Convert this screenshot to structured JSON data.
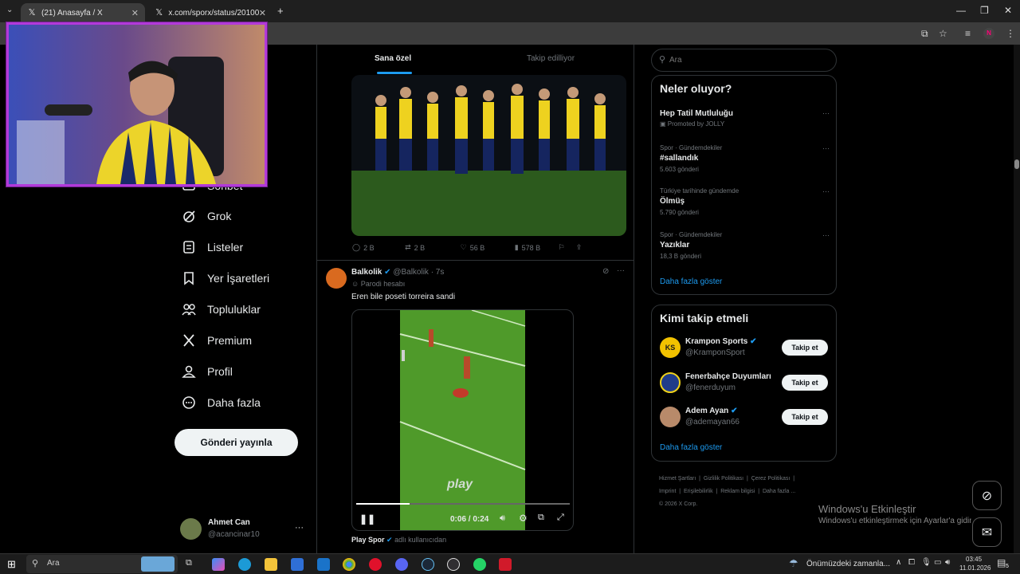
{
  "browser": {
    "tabs": [
      {
        "title": "(21) Anasayfa / X",
        "active": true
      },
      {
        "title": "x.com/sporx/status/201007797...",
        "active": false
      }
    ]
  },
  "nav": {
    "items": [
      {
        "key": "sohbet",
        "label": "Sohbet",
        "icon": "chat-icon"
      },
      {
        "key": "grok",
        "label": "Grok",
        "icon": "grok-icon"
      },
      {
        "key": "listeler",
        "label": "Listeler",
        "icon": "list-icon"
      },
      {
        "key": "yer-isaretleri",
        "label": "Yer İşaretleri",
        "icon": "bookmark-icon"
      },
      {
        "key": "topluluklar",
        "label": "Topluluklar",
        "icon": "people-icon"
      },
      {
        "key": "premium",
        "label": "Premium",
        "icon": "x-logo-icon"
      },
      {
        "key": "profil",
        "label": "Profil",
        "icon": "user-icon"
      },
      {
        "key": "daha-fazla",
        "label": "Daha fazla",
        "icon": "more-circle-icon"
      }
    ],
    "post_button": "Gönderi yayınla",
    "account": {
      "name": "Ahmet Can",
      "handle": "@acancinar10",
      "more": "···"
    }
  },
  "feed": {
    "tabs": [
      "Sana özel",
      "Takip edilliyor"
    ],
    "post1": {
      "replies": "2 B",
      "reposts": "2 B",
      "likes": "56 B",
      "views": "578 B"
    },
    "post2": {
      "name": "Balkolik",
      "handle": "@Balkolik",
      "time": "· 7s",
      "label": "Parodi hesabı",
      "text": "Eren bile poseti torreira sandi",
      "video_time": "0:06 / 0:24",
      "progress": 0.25,
      "watermark": "play",
      "source_name": "Play Spor",
      "source_suffix": "adlı kullanıcıdan"
    }
  },
  "search": {
    "placeholder": "Ara"
  },
  "trends": {
    "heading": "Neler oluyor?",
    "items": [
      {
        "meta": "",
        "title": "Hep Tatil Mutluluğu",
        "sub": "Promoted by JOLLY"
      },
      {
        "meta": "Spor · Gündemdekiler",
        "title": "#sallandık",
        "sub": "5.603 gönderi"
      },
      {
        "meta": "Türkiye tarihinde gündemde",
        "title": "Ölmüş",
        "sub": "5.790 gönderi"
      },
      {
        "meta": "Spor · Gündemdekiler",
        "title": "Yazıklar",
        "sub": "18,3 B gönderi"
      }
    ],
    "more": "Daha fazla göster"
  },
  "who_to_follow": {
    "heading": "Kimi takip etmeli",
    "items": [
      {
        "name": "Krampon Sports",
        "handle": "@KramponSport",
        "button": "Takip et"
      },
      {
        "name": "Fenerbahçe Duyumları",
        "handle": "@fenerduyum",
        "button": "Takip et"
      },
      {
        "name": "Adem Ayan",
        "handle": "@ademayan66",
        "button": "Takip et"
      }
    ],
    "more": "Daha fazla göster"
  },
  "footer": {
    "links": [
      "Hizmet Şartları",
      "Gizlilik Politikası",
      "Çerez Politikası",
      "Imprint",
      "Erişilebilirlik",
      "Reklam bilgisi",
      "Daha fazla ..."
    ],
    "copyright": "© 2026 X Corp."
  },
  "windows_activation": {
    "title": "Windows'u Etkinleştir",
    "subtitle": "Windows'u etkinleştirmek için Ayarlar'a gidin."
  },
  "taskbar": {
    "search": "Ara",
    "weather": "Önümüzdeki zamanla...",
    "time": "03:45",
    "date": "11.01.2026",
    "notif_count": "5"
  },
  "colors": {
    "accent": "#1d9bf0",
    "bg": "#000000",
    "border": "#2f3336",
    "muted": "#71767b",
    "cam_border": "#b23ad9"
  }
}
